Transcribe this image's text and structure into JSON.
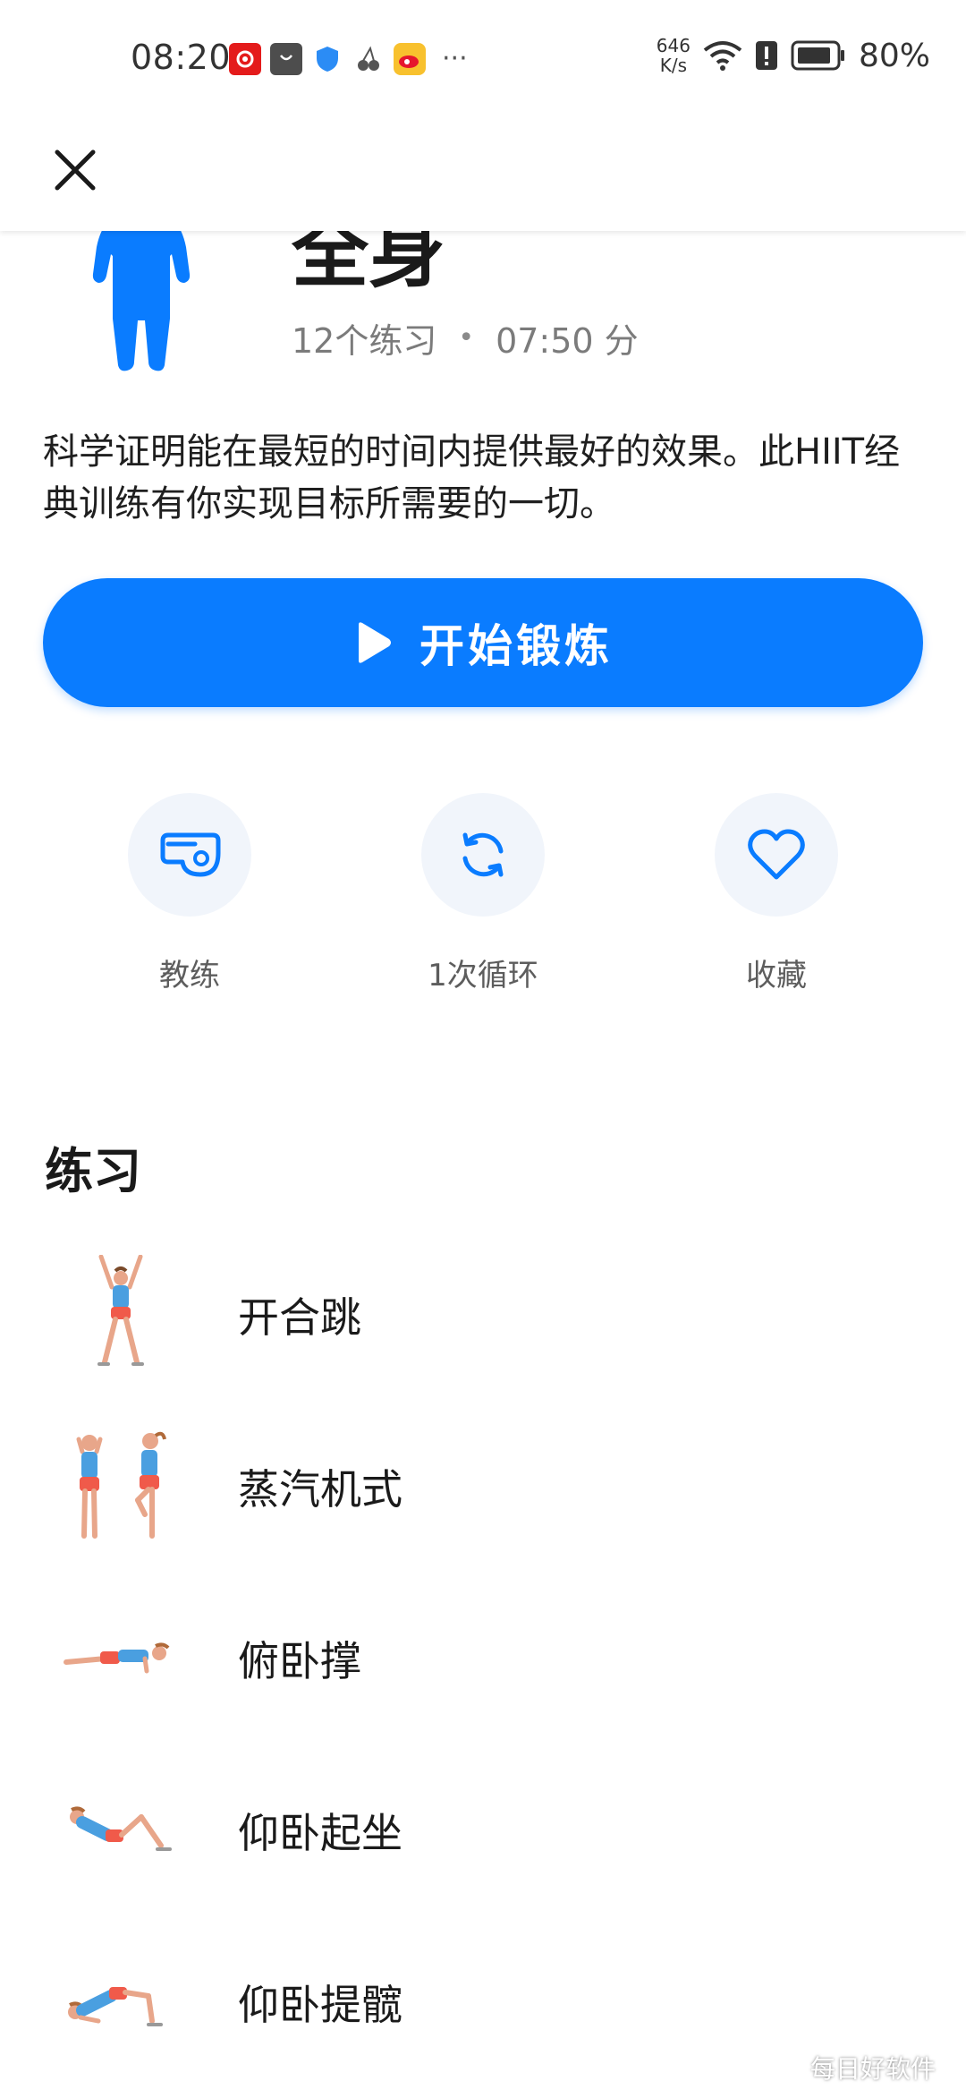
{
  "status_bar": {
    "time": "08:20",
    "net_speed_value": "646",
    "net_speed_unit": "K/s",
    "battery": "80%"
  },
  "header": {
    "close_icon": "close-icon"
  },
  "workout": {
    "title": "全身",
    "exercise_count": "12个练习",
    "separator": "•",
    "duration": "07:50 分",
    "description": "科学证明能在最短的时间内提供最好的效果。此HIIT经典训练有你实现目标所需要的一切。",
    "accent_color": "#0a7cff"
  },
  "start_button": {
    "label": "开始锻炼",
    "icon": "play-icon"
  },
  "actions": [
    {
      "label": "教练",
      "icon": "whistle-icon"
    },
    {
      "label": "1次循环",
      "icon": "repeat-icon"
    },
    {
      "label": "收藏",
      "icon": "heart-icon"
    }
  ],
  "exercises_section": {
    "title": "练习",
    "items": [
      {
        "name": "开合跳",
        "icon": "jumping-jack-figure-icon"
      },
      {
        "name": "蒸汽机式",
        "icon": "steam-engine-figure-icon"
      },
      {
        "name": "俯卧撑",
        "icon": "push-up-figure-icon"
      },
      {
        "name": "仰卧起坐",
        "icon": "sit-up-figure-icon"
      },
      {
        "name": "仰卧提髋",
        "icon": "hip-raise-figure-icon"
      }
    ]
  },
  "watermark": {
    "text": "每日好软件"
  }
}
